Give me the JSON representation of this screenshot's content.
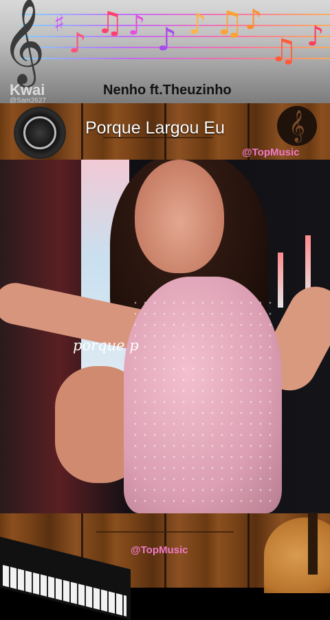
{
  "header": {
    "artist": "Nenho ft.Theuzinho",
    "watermark_app": "Kwai",
    "watermark_user": "@Sam2627"
  },
  "banner": {
    "song_title": "Porque Largou Eu",
    "channel_tag": "@TopMusic"
  },
  "video": {
    "lyric_text": "porque p"
  },
  "footer": {
    "channel_tag": "@TopMusic"
  },
  "colors": {
    "tag": "#f07ac8",
    "wood": "#7a4418",
    "title_text": "#ffffff",
    "artist_text": "#111111"
  },
  "icons": {
    "treble_clef": "treble-clef-icon",
    "speaker": "speaker-icon",
    "clef_disc": "clef-disc-icon",
    "keyboard": "keyboard-icon",
    "guitar": "guitar-icon"
  }
}
